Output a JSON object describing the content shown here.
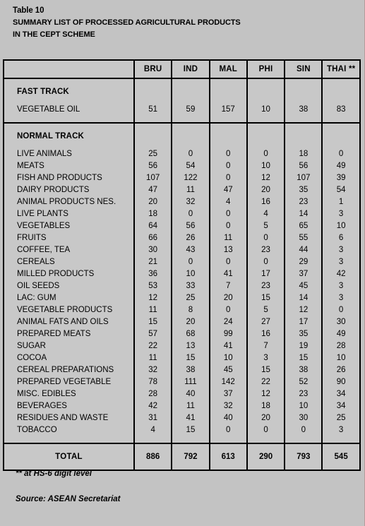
{
  "title": {
    "label": "Table 10",
    "line1": "SUMMARY LIST OF PROCESSED AGRICULTURAL PRODUCTS",
    "line2": "IN THE CEPT SCHEME"
  },
  "table": {
    "corner_header": "",
    "columns": [
      "BRU",
      "IND",
      "MAL",
      "PHI",
      "SIN",
      "THAI **"
    ],
    "sections": [
      {
        "name": "FAST TRACK",
        "rows": [
          {
            "label": "VEGETABLE OIL",
            "values": [
              "51",
              "59",
              "157",
              "10",
              "38",
              "83"
            ]
          }
        ]
      },
      {
        "name": "NORMAL TRACK",
        "rows": [
          {
            "label": "LIVE ANIMALS",
            "values": [
              "25",
              "0",
              "0",
              "0",
              "18",
              "0"
            ]
          },
          {
            "label": "MEATS",
            "values": [
              "56",
              "54",
              "0",
              "10",
              "56",
              "49"
            ]
          },
          {
            "label": "FISH AND PRODUCTS",
            "values": [
              "107",
              "122",
              "0",
              "12",
              "107",
              "39"
            ]
          },
          {
            "label": "DAIRY PRODUCTS",
            "values": [
              "47",
              "11",
              "47",
              "20",
              "35",
              "54"
            ]
          },
          {
            "label": "ANIMAL PRODUCTS NES.",
            "values": [
              "20",
              "32",
              "4",
              "16",
              "23",
              "1"
            ]
          },
          {
            "label": "LIVE PLANTS",
            "values": [
              "18",
              "0",
              "0",
              "4",
              "14",
              "3"
            ]
          },
          {
            "label": "VEGETABLES",
            "values": [
              "64",
              "56",
              "0",
              "5",
              "65",
              "10"
            ]
          },
          {
            "label": "FRUITS",
            "values": [
              "66",
              "26",
              "11",
              "0",
              "55",
              "6"
            ]
          },
          {
            "label": "COFFEE, TEA",
            "values": [
              "30",
              "43",
              "13",
              "23",
              "44",
              "3"
            ]
          },
          {
            "label": "CEREALS",
            "values": [
              "21",
              "0",
              "0",
              "0",
              "29",
              "3"
            ]
          },
          {
            "label": "MILLED PRODUCTS",
            "values": [
              "36",
              "10",
              "41",
              "17",
              "37",
              "42"
            ]
          },
          {
            "label": "OIL SEEDS",
            "values": [
              "53",
              "33",
              "7",
              "23",
              "45",
              "3"
            ]
          },
          {
            "label": "LAC: GUM",
            "values": [
              "12",
              "25",
              "20",
              "15",
              "14",
              "3"
            ]
          },
          {
            "label": "VEGETABLE PRODUCTS",
            "values": [
              "11",
              "8",
              "0",
              "5",
              "12",
              "0"
            ]
          },
          {
            "label": "ANIMAL FATS AND OILS",
            "values": [
              "15",
              "20",
              "24",
              "27",
              "17",
              "30"
            ]
          },
          {
            "label": "PREPARED MEATS",
            "values": [
              "57",
              "68",
              "99",
              "16",
              "35",
              "49"
            ]
          },
          {
            "label": "SUGAR",
            "values": [
              "22",
              "13",
              "41",
              "7",
              "19",
              "28"
            ]
          },
          {
            "label": "COCOA",
            "values": [
              "11",
              "15",
              "10",
              "3",
              "15",
              "10"
            ]
          },
          {
            "label": "CEREAL PREPARATIONS",
            "values": [
              "32",
              "38",
              "45",
              "15",
              "38",
              "26"
            ]
          },
          {
            "label": "PREPARED VEGETABLE",
            "values": [
              "78",
              "111",
              "142",
              "22",
              "52",
              "90"
            ]
          },
          {
            "label": "MISC. EDIBLES",
            "values": [
              "28",
              "40",
              "37",
              "12",
              "23",
              "34"
            ]
          },
          {
            "label": "BEVERAGES",
            "values": [
              "42",
              "11",
              "32",
              "18",
              "10",
              "34"
            ]
          },
          {
            "label": "RESIDUES AND WASTE",
            "values": [
              "31",
              "41",
              "40",
              "20",
              "30",
              "25"
            ]
          },
          {
            "label": "TOBACCO",
            "values": [
              "4",
              "15",
              "0",
              "0",
              "0",
              "3"
            ]
          }
        ]
      }
    ],
    "total": {
      "label": "TOTAL",
      "values": [
        "886",
        "792",
        "613",
        "290",
        "793",
        "545"
      ]
    }
  },
  "footer": {
    "note": "** at HS-6 digit level",
    "source": "Source: ASEAN Secretariat"
  },
  "colors": {
    "page_background": "#c3c3c3",
    "cell_background": "#c8c8c8",
    "border": "#000000",
    "text": "#000000",
    "edge_line": "#b59a9a"
  }
}
